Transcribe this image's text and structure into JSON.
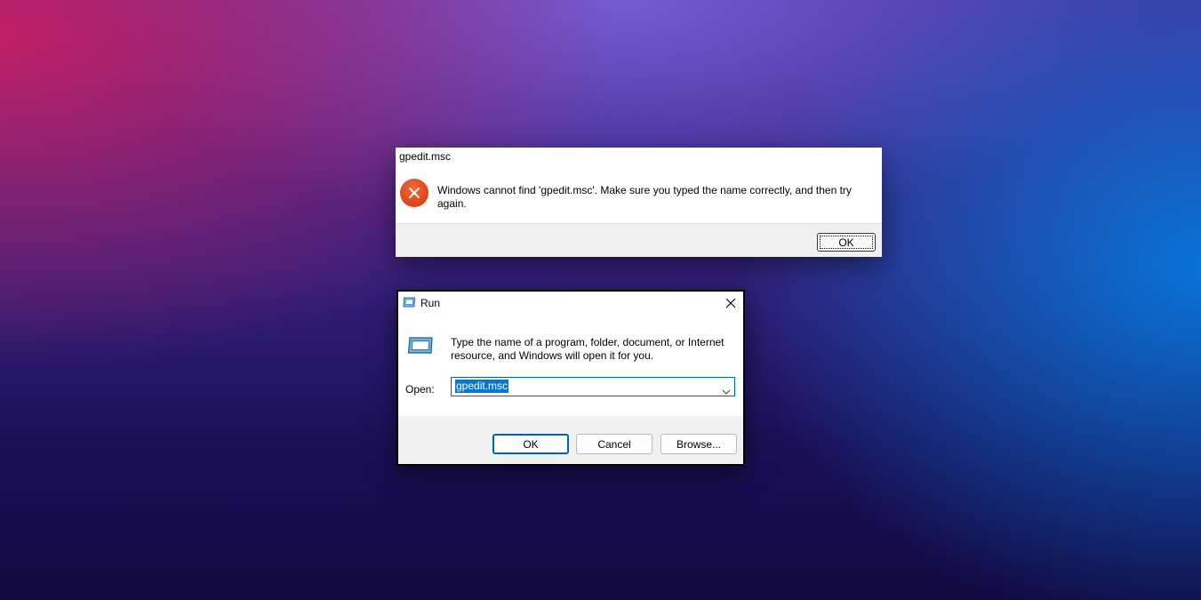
{
  "error_dialog": {
    "title": "gpedit.msc",
    "message": "Windows cannot find 'gpedit.msc'. Make sure you typed the name correctly, and then try again.",
    "ok_label": "OK",
    "icon": "error-x-icon",
    "icon_color": "#e0481c"
  },
  "run_dialog": {
    "title": "Run",
    "description": "Type the name of a program, folder, document, or Internet resource, and Windows will open it for you.",
    "open_label": "Open:",
    "open_value": "gpedit.msc",
    "ok_label": "OK",
    "cancel_label": "Cancel",
    "browse_label": "Browse...",
    "accent_color": "#0063b1"
  }
}
